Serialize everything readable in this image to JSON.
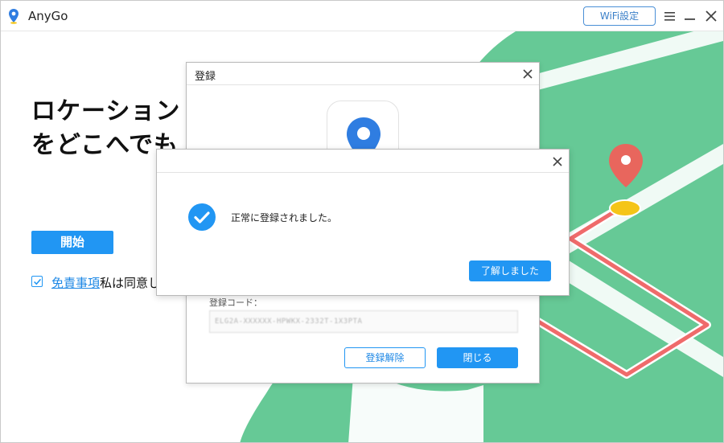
{
  "app": {
    "title": "AnyGo",
    "wifi_button_label": "WiFi設定",
    "icons": {
      "logo": "location-pin-icon",
      "menu": "hamburger-menu-icon",
      "minimize": "minimize-icon",
      "close": "close-icon"
    }
  },
  "main": {
    "hero_line1": "ロケーション",
    "hero_line2": "をどこへでも",
    "start_button_label": "開始",
    "agree_checked": true,
    "disclaimer_link": "免責事項",
    "agree_text": "私は同意し"
  },
  "register_dialog": {
    "title": "登録",
    "code_label": "登録コード：",
    "code_value": "ELG2A-XXXXXX-HPWKX-2332T-1X3PTA",
    "unregister_label": "登録解除",
    "close_label": "閉じる"
  },
  "success_dialog": {
    "message": "正常に登録されました。",
    "ok_label": "了解しました"
  },
  "colors": {
    "accent": "#2196f3",
    "map_green": "#66c996",
    "route_red": "#ef6b6b",
    "marker_yellow": "#f5c518",
    "pin_red": "#e8665d"
  }
}
